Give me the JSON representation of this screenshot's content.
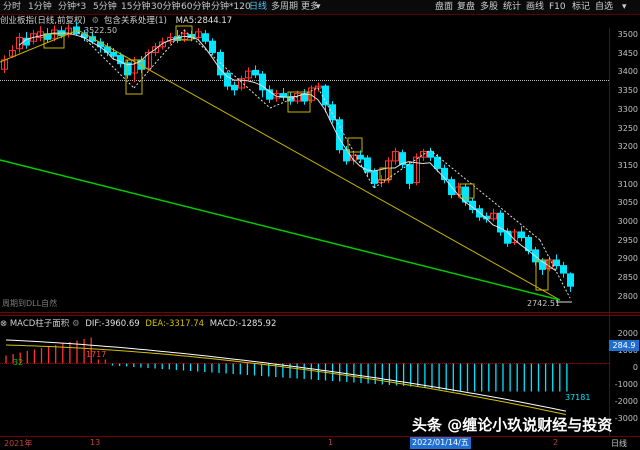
{
  "toolbar": {
    "left": [
      "分时",
      "1分钟",
      "分钟*3",
      "5分钟",
      "15分钟",
      "30分钟",
      "60分钟",
      "分钟*120",
      "日线",
      "多周期",
      "更多"
    ],
    "active": "日线",
    "right": [
      "盘面",
      "复盘",
      "多股",
      "统计",
      "画线",
      "F10",
      "标记",
      "自选"
    ]
  },
  "infobar": {
    "name": "创业板指(日线,前复权)",
    "indicator": "包含关系处理(1)",
    "ma_label": "MA5:",
    "ma_value": "2844.17"
  },
  "price_axis": [
    "3500",
    "3450",
    "3400",
    "3350",
    "3300",
    "3250",
    "3200",
    "3150",
    "3100",
    "3050",
    "3000",
    "2950",
    "2900",
    "2850",
    "2800"
  ],
  "annotations": {
    "high": "3522.50",
    "low": "2742.51",
    "left_note": "周期到DLL自然"
  },
  "macd": {
    "title": "MACD柱子面积",
    "dif_label": "DIF:",
    "dif_value": "-3960.69",
    "dea_label": "DEA:",
    "dea_value": "-3317.74",
    "macd_label": "MACD:",
    "macd_value": "-1285.92",
    "area_pos": "1717",
    "area_small": "32",
    "area_neg": "37181",
    "axis": [
      "2000",
      "1000",
      "0",
      "-1000",
      "-2000",
      "-3000"
    ],
    "badge": "284.9"
  },
  "dates": {
    "d1": "2021年",
    "d2": "13",
    "d3": "1",
    "d4": "2022/01/14/五",
    "d5": "2",
    "period": "日线"
  },
  "watermark": "头条 @缠论小玖说财经与投资",
  "colors": {
    "up": "#ff3232",
    "down": "#00e5ff",
    "ma": "#e0e0e0",
    "trend": "#c8b400",
    "green": "#00d000"
  }
}
